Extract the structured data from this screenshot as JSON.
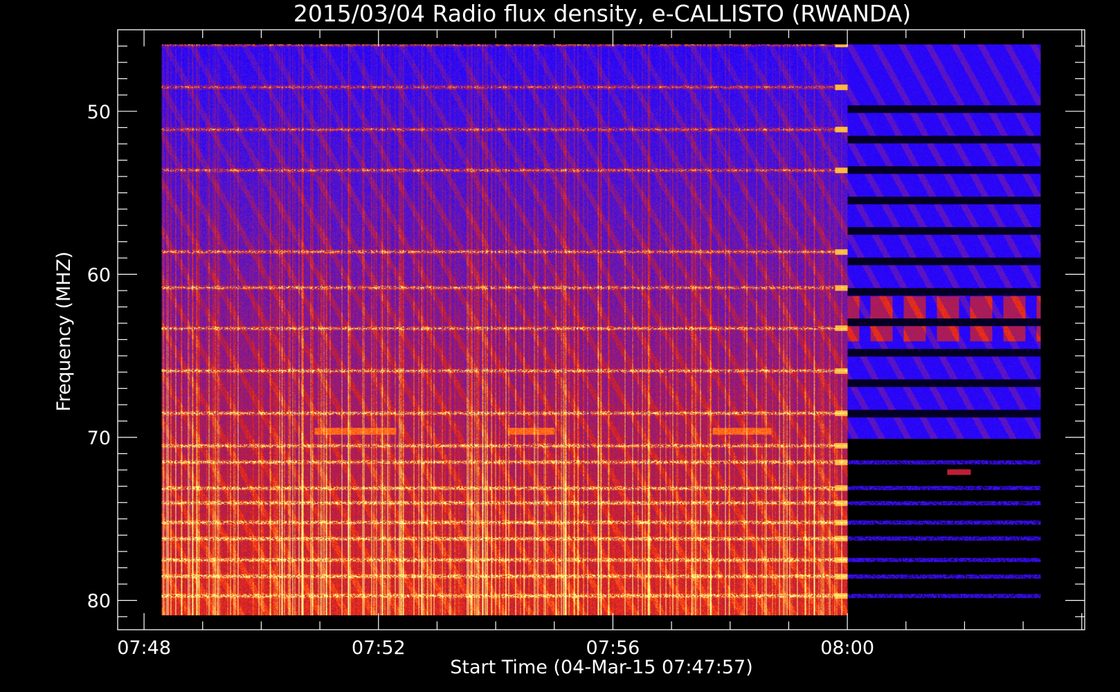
{
  "chart_data": {
    "type": "heatmap",
    "title": "2015/03/04  Radio flux density, e-CALLISTO (RWANDA)",
    "xlabel": "Start Time (04-Mar-15 07:47:57)",
    "ylabel": "Frequency (MHZ)",
    "x_ticks": [
      "07:48",
      "07:52",
      "07:56",
      "08:00"
    ],
    "x_tick_minutes": [
      0,
      4,
      8,
      12
    ],
    "x_range_minutes": [
      -0.45,
      16.05
    ],
    "data_x_range_minutes": [
      0.3,
      15.3
    ],
    "data_x_break_minutes": 12.0,
    "y_ticks": [
      50,
      60,
      70,
      80
    ],
    "y_range": [
      45.0,
      81.8
    ],
    "data_y_range": [
      45.9,
      80.9
    ],
    "y_inverted": true,
    "colormap": [
      "#000000",
      "#1e00ff",
      "#3c10e8",
      "#8a1a8a",
      "#c81e2a",
      "#ff3a10",
      "#ffaa30",
      "#ffff90"
    ],
    "bright_lines_mhz": [
      45.9,
      48.5,
      51.1,
      53.6,
      58.6,
      60.8,
      63.3,
      65.9,
      68.5,
      70.5,
      71.5,
      73.1,
      74.0,
      75.2,
      76.2,
      77.5,
      78.5,
      79.7
    ],
    "bursts": [
      {
        "t_start": 2.9,
        "t_end": 4.3,
        "freq_mhz": 69.6
      },
      {
        "t_start": 6.2,
        "t_end": 7.0,
        "freq_mhz": 69.6
      },
      {
        "t_start": 9.7,
        "t_end": 10.7,
        "freq_mhz": 69.6
      },
      {
        "t_start": 13.7,
        "t_end": 14.1,
        "freq_mhz": 72.1
      }
    ]
  }
}
